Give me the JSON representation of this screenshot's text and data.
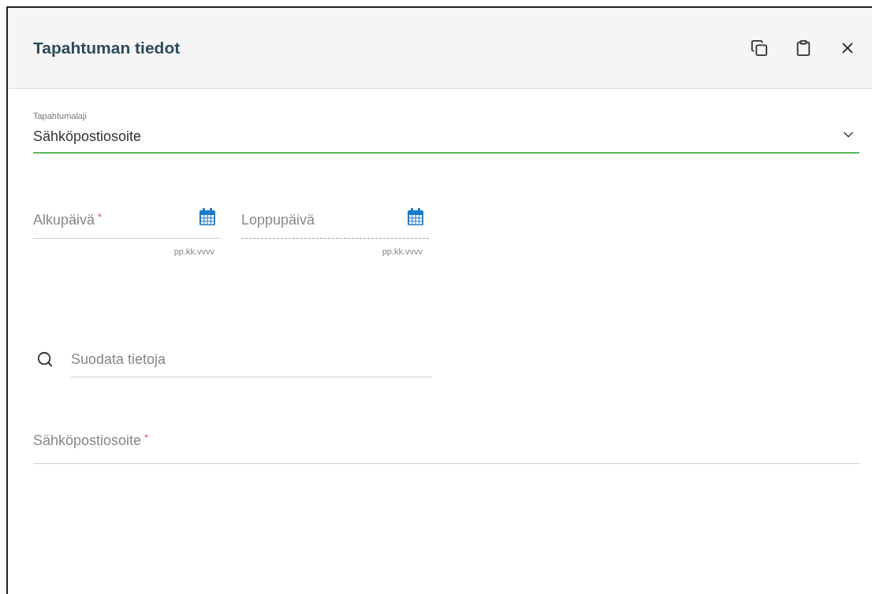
{
  "dialog": {
    "title": "Tapahtuman tiedot"
  },
  "event_type": {
    "label": "Tapahtumalaji",
    "value": "Sähköpostiosoite",
    "focused": true
  },
  "dates": [
    {
      "label": "Alkupäivä",
      "required_mark": "*",
      "disabled": false,
      "hint": "pp.kk.vvvv"
    },
    {
      "label": "Loppupäivä",
      "disabled": true,
      "hint": "pp.kk.vvvv"
    }
  ],
  "filter": {
    "placeholder": "Suodata tietoja"
  },
  "email": {
    "label": "Sähköpostiosoite",
    "required_mark": "*"
  }
}
